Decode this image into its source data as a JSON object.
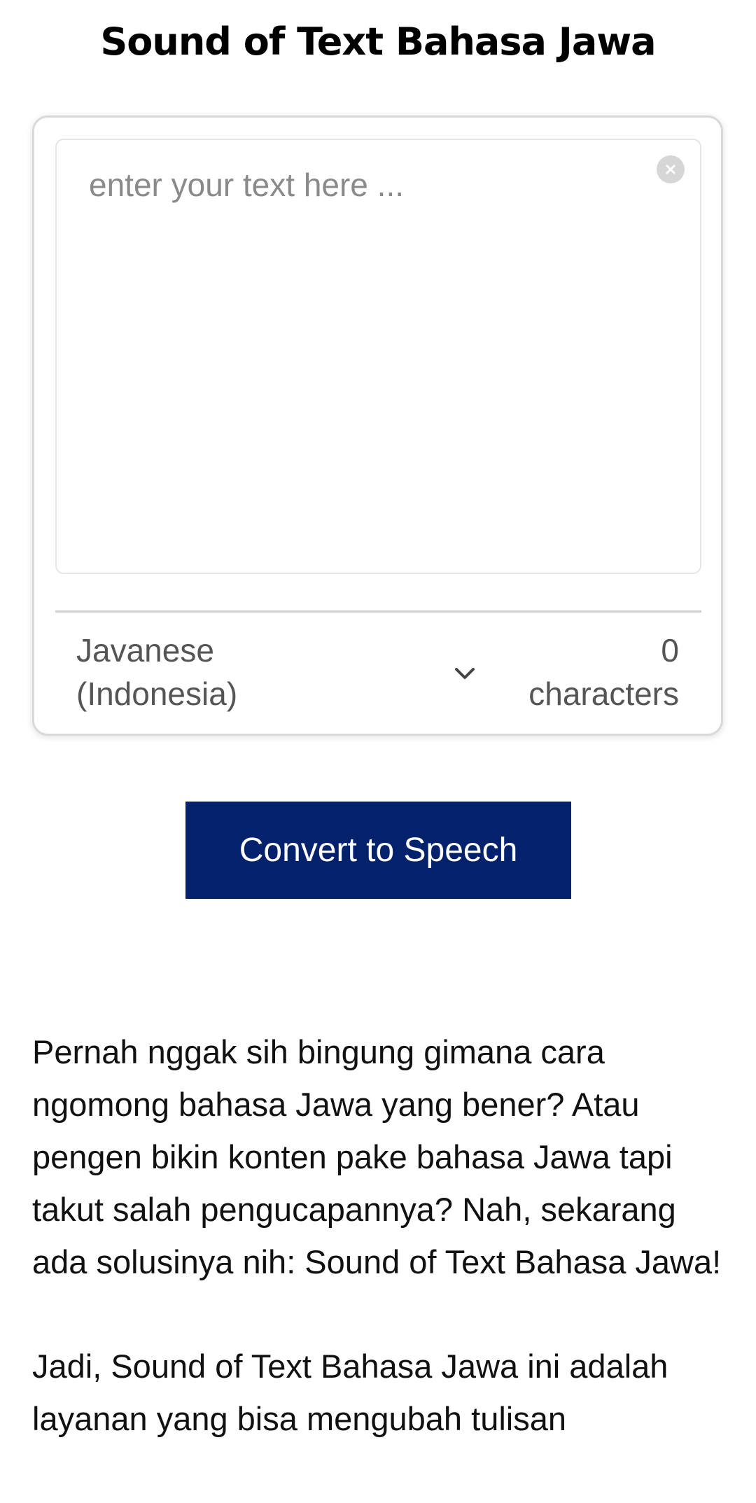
{
  "page": {
    "title": "Sound of Text Bahasa Jawa"
  },
  "converter": {
    "text_placeholder": "enter your text here ...",
    "text_value": "",
    "language_selected": "Javanese (Indonesia)",
    "char_count": "0",
    "char_count_label": "characters",
    "convert_label": "Convert to Speech"
  },
  "article": {
    "paragraphs": [
      "Pernah nggak sih bingung gimana cara ngomong bahasa Jawa yang bener? Atau pengen bikin konten pake bahasa Jawa tapi takut salah pengucapannya? Nah, sekarang ada solusinya nih: Sound of Text Bahasa Jawa!",
      "Jadi, Sound of Text Bahasa Jawa ini adalah layanan yang bisa mengubah tulisan"
    ]
  },
  "colors": {
    "button_bg": "#03226b",
    "button_text": "#ffffff",
    "muted_text": "#555555"
  },
  "icons": {
    "clear": "close-circle-icon",
    "dropdown": "chevron-down-icon"
  }
}
